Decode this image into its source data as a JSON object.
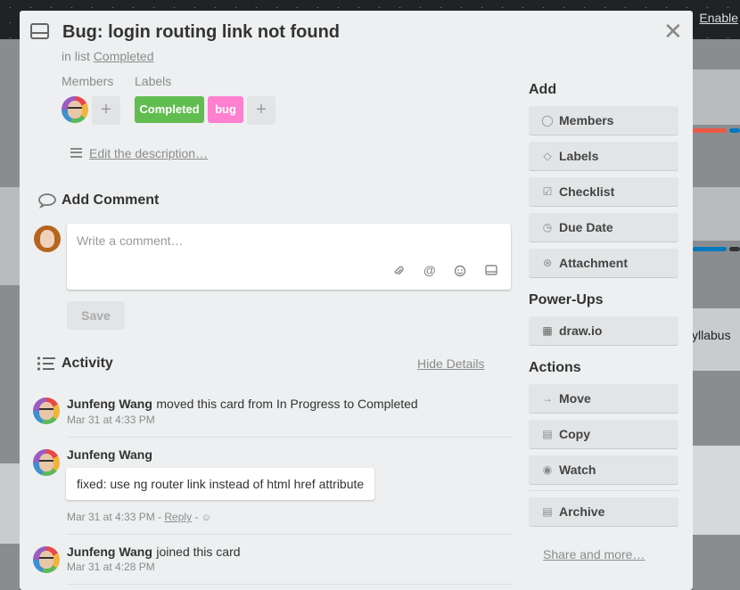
{
  "background": {
    "enable_label": "Enable",
    "right_text": "yllabus"
  },
  "card": {
    "title": "Bug: login routing link not found",
    "in_list_prefix": "in list",
    "list_name": "Completed"
  },
  "members": {
    "heading": "Members",
    "add": "+"
  },
  "labels": {
    "heading": "Labels",
    "items": [
      {
        "text": "Completed",
        "color": "#61bd4f"
      },
      {
        "text": "bug",
        "color": "#ff80ce"
      }
    ],
    "add": "+"
  },
  "description": {
    "edit_link": "Edit the description…"
  },
  "comment": {
    "heading": "Add Comment",
    "placeholder": "Write a comment…",
    "save_label": "Save"
  },
  "activity": {
    "heading": "Activity",
    "hide_details": "Hide Details",
    "items": [
      {
        "name": "Junfeng Wang",
        "text": "moved this card from In Progress to Completed",
        "date": "Mar 31 at 4:33 PM"
      },
      {
        "name": "Junfeng Wang",
        "comment": "fixed: use ng router link instead of html href attribute",
        "date": "Mar 31 at 4:33 PM",
        "date_sep": " - ",
        "reply": "Reply",
        "tail": " - "
      },
      {
        "name": "Junfeng Wang",
        "text": "joined this card",
        "date": "Mar 31 at 4:28 PM"
      }
    ]
  },
  "sidebar": {
    "add_heading": "Add",
    "add_buttons": [
      {
        "label": "Members",
        "icon": "person-icon"
      },
      {
        "label": "Labels",
        "icon": "tag-icon"
      },
      {
        "label": "Checklist",
        "icon": "checkbox-icon"
      },
      {
        "label": "Due Date",
        "icon": "clock-icon"
      },
      {
        "label": "Attachment",
        "icon": "paperclip-icon"
      }
    ],
    "powerups_heading": "Power-Ups",
    "powerups": [
      {
        "label": "draw.io",
        "icon": "drawio-icon"
      }
    ],
    "actions_heading": "Actions",
    "actions": [
      {
        "label": "Move",
        "icon": "arrow-right-icon"
      },
      {
        "label": "Copy",
        "icon": "card-icon"
      },
      {
        "label": "Watch",
        "icon": "eye-icon"
      },
      {
        "label": "Archive",
        "icon": "archive-icon"
      }
    ],
    "share": "Share and more…"
  }
}
